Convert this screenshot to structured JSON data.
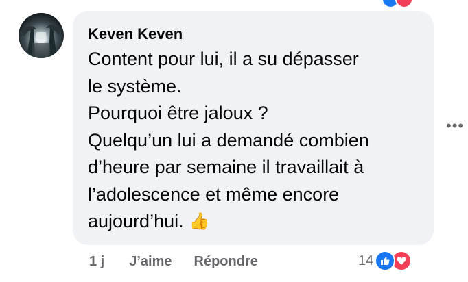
{
  "comment": {
    "author": "Keven Keven",
    "lines": [
      "Content pour lui, il a su dépasser",
      "le système.",
      "Pourquoi être jaloux ?",
      "Quelqu’un lui a demandé combien",
      "d’heure par semaine il travaillait à",
      "l’adolescence et même encore",
      "aujourd’hui."
    ],
    "emoji": "👍"
  },
  "actions": {
    "time": "1 j",
    "like_label": "J’aime",
    "reply_label": "Répondre"
  },
  "reactions": {
    "count": "14",
    "types": [
      "like-icon",
      "love-icon"
    ]
  },
  "colors": {
    "bubble": "#f0f2f5",
    "text": "#050505",
    "secondary": "#65676b",
    "like": "#1877f2",
    "love": "#f33e58"
  },
  "icons": {
    "more": "more-options-icon"
  }
}
